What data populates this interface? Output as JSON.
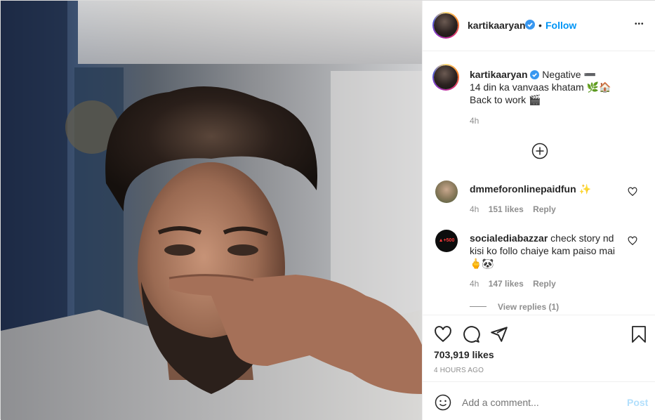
{
  "post": {
    "username": "kartikaaryan",
    "follow_separator": "•",
    "follow_label": "Follow",
    "more_label": "•••"
  },
  "caption": {
    "username": "kartikaaryan",
    "line1": "Negative ➖",
    "line2": "14 din ka vanvaas khatam 🌿🏠",
    "line3": "Back to work 🎬",
    "time": "4h"
  },
  "comments": [
    {
      "username": "dmmeforonlinepaidfun",
      "text": "✨",
      "time": "4h",
      "likes": "151 likes",
      "reply_label": "Reply"
    },
    {
      "username": "socialediabazzar",
      "text": "check story nd kisi ko follo chaiye kam paiso mai 🖕🐼",
      "time": "4h",
      "likes": "147 likes",
      "reply_label": "Reply",
      "view_replies": "View replies (1)",
      "avatar_text": "▲+500"
    }
  ],
  "stats": {
    "likes": "703,919 likes",
    "posted": "4 HOURS AGO"
  },
  "composer": {
    "placeholder": "Add a comment...",
    "post_label": "Post"
  },
  "colors": {
    "accent": "#0095f6",
    "muted": "#8e8e8e",
    "post_disabled": "#b2dffc",
    "verified": "#3897f0"
  }
}
